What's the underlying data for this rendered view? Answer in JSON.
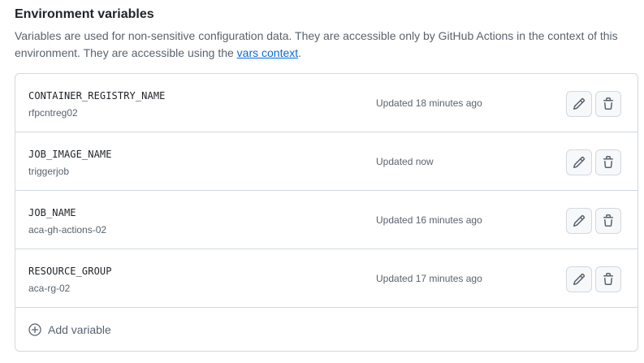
{
  "section": {
    "title": "Environment variables",
    "description_before_link": "Variables are used for non-sensitive configuration data. They are accessible only by GitHub Actions in the context of this environment. They are accessible using the ",
    "link_text": "vars context",
    "description_after_link": "."
  },
  "variables": [
    {
      "name": "CONTAINER_REGISTRY_NAME",
      "value": "rfpcntreg02",
      "updated": "Updated 18 minutes ago"
    },
    {
      "name": "JOB_IMAGE_NAME",
      "value": "triggerjob",
      "updated": "Updated now"
    },
    {
      "name": "JOB_NAME",
      "value": "aca-gh-actions-02",
      "updated": "Updated 16 minutes ago"
    },
    {
      "name": "RESOURCE_GROUP",
      "value": "aca-rg-02",
      "updated": "Updated 17 minutes ago"
    }
  ],
  "actions": {
    "edit_icon": "pencil-icon",
    "delete_icon": "trash-icon",
    "add_icon": "plus-circle-icon",
    "add_label": "Add variable"
  },
  "colors": {
    "link": "#0969da",
    "border": "#d1d9e0",
    "muted_text": "#59636e",
    "button_bg": "#f6f8fa"
  }
}
